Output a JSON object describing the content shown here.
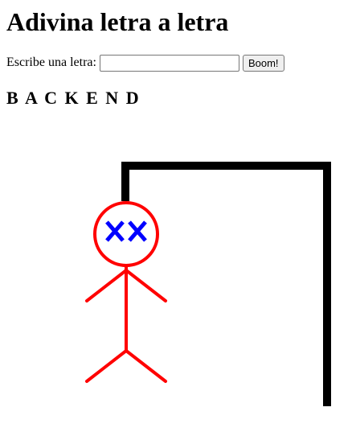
{
  "title": "Adivina letra a letra",
  "form": {
    "label": "Escribe una letra:",
    "input_value": "",
    "button_label": "Boom!"
  },
  "word": {
    "letters": [
      "B",
      "A",
      "C",
      "K",
      "E",
      "N",
      "D"
    ],
    "display": "B A C K E N D"
  },
  "drawing": {
    "gallows_color": "#000000",
    "body_color": "#ff0000",
    "eyes_color": "#0000ff",
    "eyes": "XX"
  }
}
